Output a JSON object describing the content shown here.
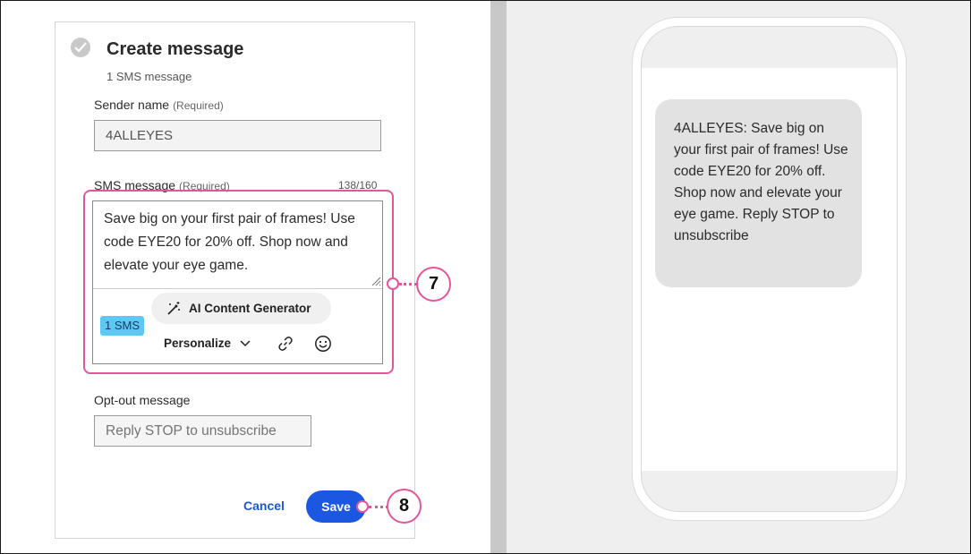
{
  "form": {
    "title": "Create message",
    "subtitle": "1 SMS message",
    "sender_label": "Sender name",
    "required_text": "(Required)",
    "sender_value": "4ALLEYES",
    "sms_label": "SMS message",
    "char_counter": "138/160",
    "sms_text": "Save big on your first pair of frames! Use code EYE20 for 20% off. Shop now and elevate your eye game.",
    "ai_button_label": "AI Content Generator",
    "sms_count_badge": "1 SMS",
    "personalize_label": "Personalize",
    "optout_label": "Opt-out message",
    "optout_placeholder": "Reply STOP to unsubscribe",
    "cancel_label": "Cancel",
    "save_label": "Save"
  },
  "callouts": {
    "message_box": "7",
    "save": "8"
  },
  "preview": {
    "bubble_text": "4ALLEYES: Save big on your first pair of frames! Use code EYE20 for 20% off. Shop now and elevate your eye game. Reply STOP to unsubscribe"
  },
  "colors": {
    "accent": "#1b57e0",
    "callout": "#e5559a",
    "badge": "#5ec8f2"
  },
  "icons": [
    "check-icon",
    "magic-wand-icon",
    "chevron-down-icon",
    "link-icon",
    "emoji-icon",
    "resize-handle-icon"
  ]
}
